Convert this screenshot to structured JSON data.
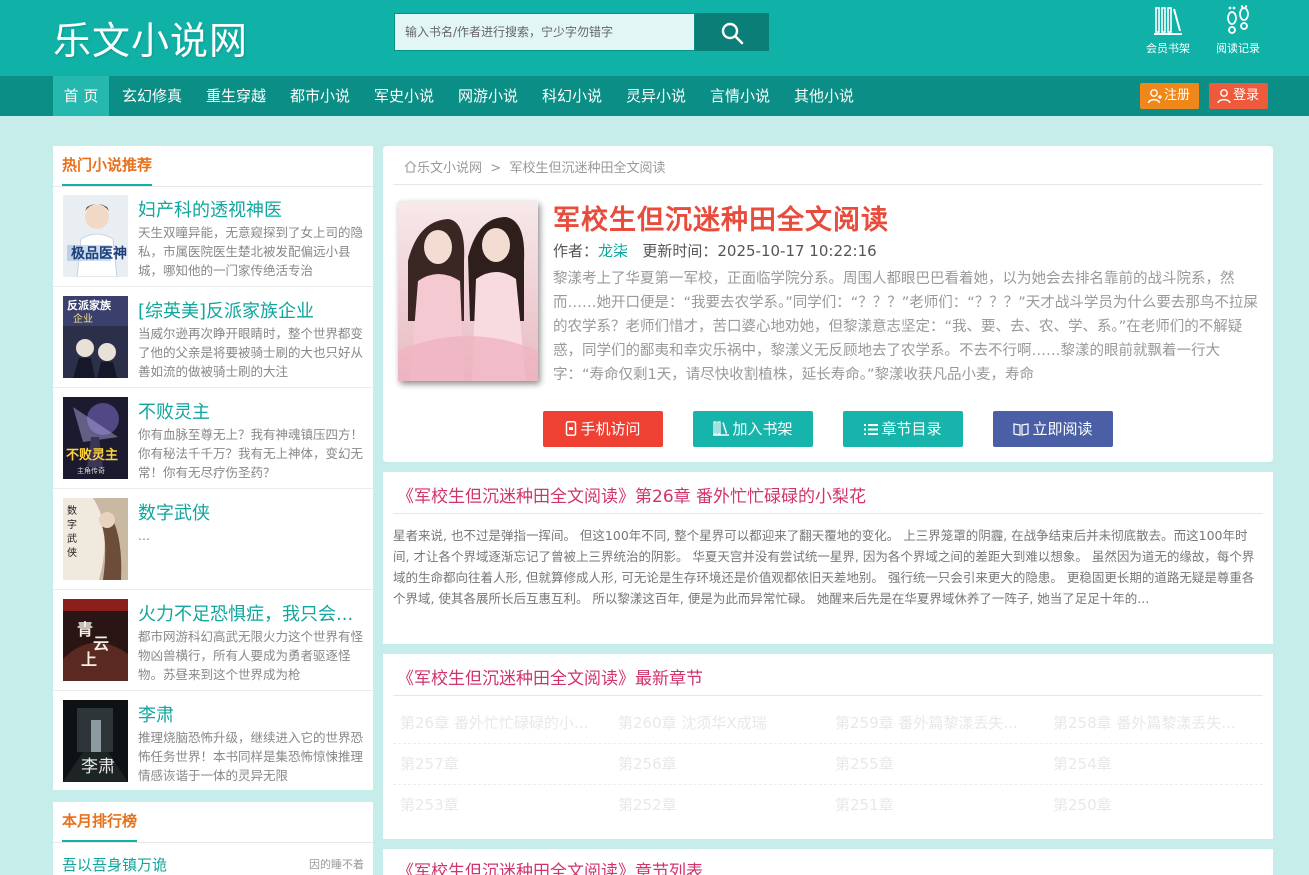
{
  "site": {
    "logo": "乐文小说网",
    "search_placeholder": "输入书名/作者进行搜索，宁少字勿错字",
    "shelf_label": "会员书架",
    "history_label": "阅读记录"
  },
  "nav": {
    "items": [
      "首 页",
      "玄幻修真",
      "重生穿越",
      "都市小说",
      "军史小说",
      "网游小说",
      "科幻小说",
      "灵异小说",
      "言情小说",
      "其他小说"
    ],
    "register": "注册",
    "login": "登录"
  },
  "sidebar": {
    "hot_title": "热门小说推荐",
    "hot_items": [
      {
        "name": "妇产科的透视神医",
        "desc": "天生双瞳异能，无意窥探到了女上司的隐私，市属医院医生楚北被发配偏远小县城，哪知他的一门家传绝活专治"
      },
      {
        "name": "[综英美]反派家族企业",
        "desc": "当威尔逊再次睁开眼睛时，整个世界都变了他的父亲是将要被骑士刷的大也只好从善如流的做被骑士刷的大注"
      },
      {
        "name": "不败灵主",
        "desc": "你有血脉至尊无上？我有神魂镇压四方！你有秘法千千万？我有无上神体，变幻无常！你有无尽疗伤圣药？"
      },
      {
        "name": "数字武侠",
        "desc": "..."
      },
      {
        "name": "火力不足恐惧症，我只会...",
        "desc": "都市网游科幻高武无限火力这个世界有怪物凶兽横行，所有人要成为勇者驱逐怪物。苏昼来到这个世界成为枪"
      },
      {
        "name": "李肃",
        "desc": "推理烧脑恐怖升级，继续进入它的世界恐怖任务世界！本书同样是集恐怖惊悚推理情感诙谐于一体的灵异无限"
      }
    ],
    "rank_title": "本月排行榜",
    "rank_first": {
      "name": "吾以吾身镇万诡",
      "author": "因的睡不着"
    }
  },
  "book": {
    "crumb_home": "乐文小说网",
    "crumb_sep": ">",
    "crumb_current": "军校生但沉迷种田全文阅读",
    "title": "军校生但沉迷种田全文阅读",
    "author_label": "作者：",
    "author": "龙柒",
    "update_label": "更新时间：",
    "update_time": "2025-10-17 10:22:16",
    "intro": "黎漾考上了华夏第一军校，正面临学院分系。周围人都眼巴巴看着她，以为她会去排名靠前的战斗院系，然而……她开口便是：“我要去农学系。”同学们：“？？？”老师们：“？？？”天才战斗学员为什么要去那鸟不拉屎的农学系？老师们惜才，苦口婆心地劝她，但黎漾意志坚定：“我、要、去、农、学、系。”在老师们的不解疑惑，同学们的鄙夷和幸灾乐祸中，黎漾义无反顾地去了农学系。不去不行啊……黎漾的眼前就飘着一行大字：“寿命仅剩1天，请尽快收割植株，延长寿命。”黎漾收获凡品小麦，寿命",
    "btn_mobile": "手机访问",
    "btn_shelf": "加入书架",
    "btn_catalog": "章节目录",
    "btn_read": "立即阅读"
  },
  "latest_chapter": {
    "title": "《军校生但沉迷种田全文阅读》第26章 番外忙忙碌碌的小梨花",
    "excerpt": "星者来说, 也不过是弹指一挥间。 但这100年不同, 整个星界可以都迎来了翻天覆地的变化。 上三界笼罩的阴霾, 在战争结束后并未彻底散去。而这100年时间, 才让各个界域逐渐忘记了曾被上三界统治的阴影。 华夏天宫并没有尝试统一星界, 因为各个界域之间的差距大到难以想象。 虽然因为道无的缘故，每个界域的生命都向往着人形, 但就算修成人形, 可无论是生存环境还是价值观都依旧天差地别。 强行统一只会引来更大的隐患。 更稳固更长期的道路无疑是尊重各个界域, 使其各展所长后互惠互利。 所以黎漾这百年, 便是为此而异常忙碌。 她醒来后先是在华夏界域休养了一阵子, 她当了足足十年的..."
  },
  "newest": {
    "title": "《军校生但沉迷种田全文阅读》最新章节",
    "chapters": [
      "第26章 番外忙忙碌碌的小...",
      "第260章 沈须华X成瑞",
      "第259章 番外篇黎漾丢失...",
      "第258章 番外篇黎漾丢失...",
      "第257章",
      "第256章",
      "第255章",
      "第254章",
      "第253章",
      "第252章",
      "第251章",
      "第250章"
    ]
  },
  "chapter_list": {
    "title": "《军校生但沉迷种田全文阅读》章节列表"
  },
  "colors": {
    "brand": "#10b2a8",
    "nav": "#0a8e85",
    "accent_red": "#e84c3d",
    "chapter_title": "#d0336e"
  }
}
